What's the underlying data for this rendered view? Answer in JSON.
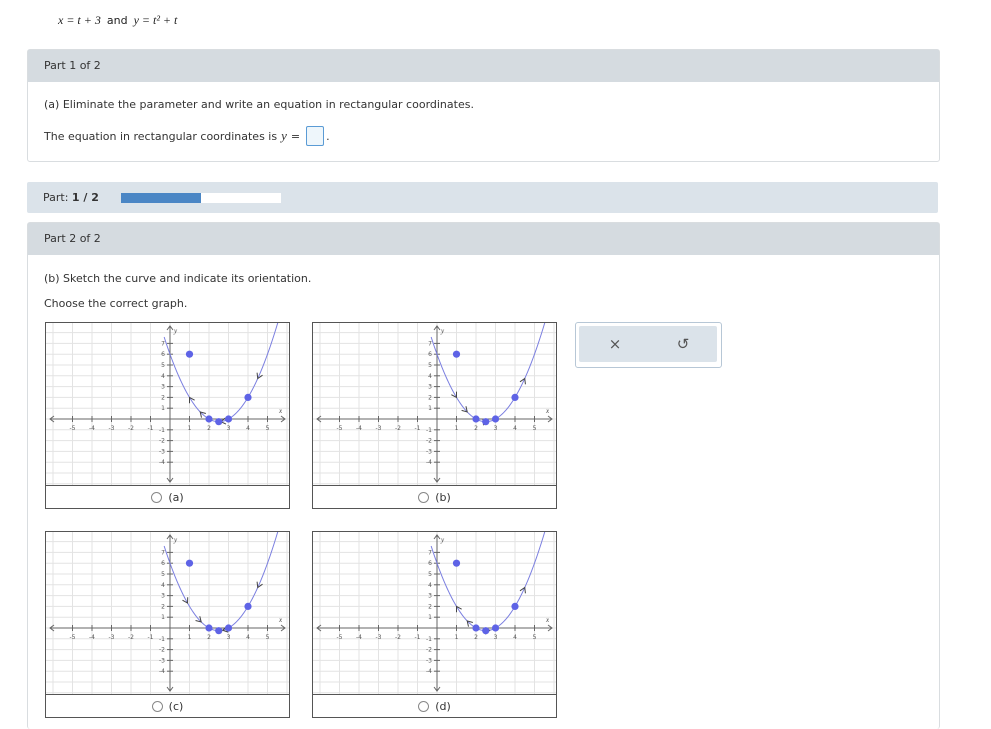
{
  "given": {
    "x_eq": "x = t + 3",
    "and": "and",
    "y_eq": "y = t² + t"
  },
  "part1": {
    "header": "Part 1 of 2",
    "question": "(a) Eliminate the parameter and write an equation in rectangular coordinates.",
    "answer_prefix": "The equation in rectangular coordinates is",
    "answer_var": "y",
    "answer_eq": "=",
    "answer_value": ""
  },
  "progress": {
    "label": "Part:",
    "value": "1 / 2",
    "fraction": 0.5
  },
  "part2": {
    "header": "Part 2 of 2",
    "question": "(b) Sketch the curve and indicate its orientation.",
    "prompt": "Choose the correct graph.",
    "options": [
      {
        "label": "(a)",
        "arrows": "down"
      },
      {
        "label": "(b)",
        "arrows": "up"
      },
      {
        "label": "(c)",
        "arrows": "mixed-c"
      },
      {
        "label": "(d)",
        "arrows": "mixed-d"
      }
    ]
  },
  "graph_common": {
    "x_ticks": [
      "-5",
      "-4",
      "-3",
      "-2",
      "-1",
      "1",
      "2",
      "3",
      "4",
      "5"
    ],
    "y_ticks": [
      "7",
      "6",
      "5",
      "4",
      "3",
      "2",
      "1",
      "-1",
      "-2",
      "-3",
      "-4"
    ],
    "x_label": "x",
    "y_label": "y",
    "points": [
      [
        1,
        6
      ],
      [
        2.5,
        -0.25
      ],
      [
        3,
        0
      ],
      [
        2,
        0
      ],
      [
        4,
        2
      ]
    ],
    "colors": {
      "curve": "#7b7fe0",
      "point": "#5e63e6",
      "grid": "#e3e3e3",
      "axis": "#666"
    }
  },
  "toolbar": {
    "close_icon": "×",
    "reset_icon": "↺"
  }
}
